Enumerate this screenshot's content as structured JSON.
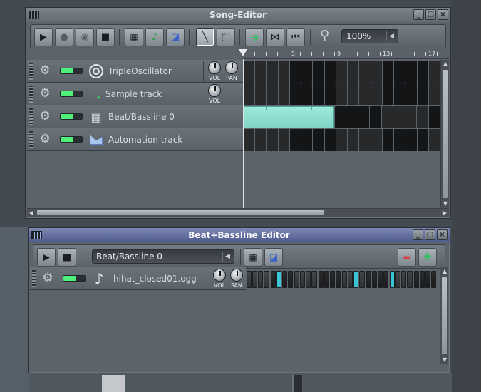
{
  "song_editor": {
    "title": "Song-Editor",
    "zoom": "100%",
    "ruler": [
      "5",
      "9",
      "13",
      "17"
    ],
    "tracks": [
      {
        "name": "TripleOscillator",
        "knobs": [
          "VOL",
          "PAN"
        ]
      },
      {
        "name": "Sample track",
        "knobs": [
          "VOL"
        ]
      },
      {
        "name": "Beat/Bassline 0",
        "knobs": []
      },
      {
        "name": "Automation track",
        "knobs": []
      }
    ],
    "window_buttons": [
      "_",
      "□",
      "×"
    ]
  },
  "bb_editor": {
    "title": "Beat+Bassline Editor",
    "selected_bb": "Beat/Bassline 0",
    "track_name": "hihat_closed01.ogg",
    "knob_labels": [
      "VOL",
      "PAN"
    ],
    "steps": [
      0,
      0,
      0,
      0,
      0,
      1,
      0,
      0,
      0,
      0,
      0,
      0,
      0,
      0,
      0,
      0,
      0,
      0,
      1,
      0,
      0,
      0,
      0,
      0,
      1,
      0,
      0,
      0,
      0,
      0,
      0,
      0
    ],
    "window_buttons": [
      "_",
      "□",
      "×"
    ]
  },
  "colors": {
    "accent_active_title": "#4e5a8a",
    "step_on": "#39c4d8",
    "bb_pattern": "#8fe3d5",
    "led_on": "#4ef07a"
  },
  "icons": {
    "play": "play-icon",
    "record": "record-icon",
    "record_play": "record-while-playing-icon",
    "stop": "stop-icon",
    "add_bb": "add-beat-bassline-icon",
    "add_sample": "add-sample-track-icon",
    "add_automation": "add-automation-track-icon",
    "draw": "draw-mode-icon",
    "select": "select-mode-icon",
    "auto_scroll": "auto-scroll-icon",
    "loop_points": "loop-points-icon",
    "back_to_start": "back-to-start-icon",
    "zoom": "zoom-icon"
  }
}
